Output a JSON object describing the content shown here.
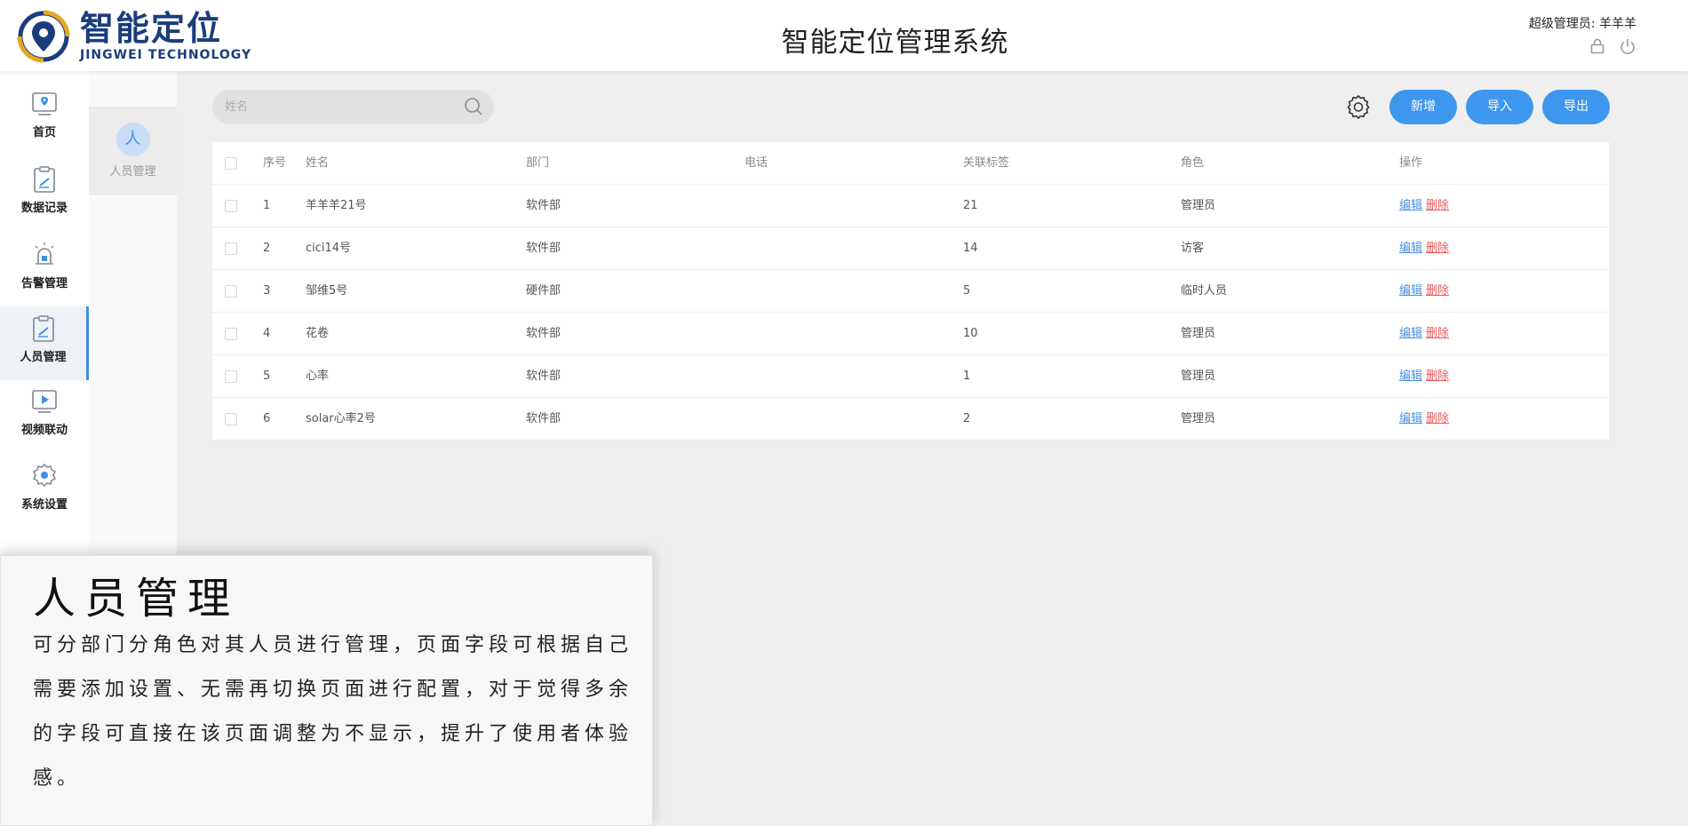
{
  "header": {
    "logo_cn": "智能定位",
    "logo_en": "JINGWEI TECHNOLOGY",
    "title": "智能定位管理系统",
    "admin_label": "超级管理员:  羊羊羊"
  },
  "sidebar": {
    "items": [
      {
        "label": "首页",
        "icon": "home-map-icon"
      },
      {
        "label": "数据记录",
        "icon": "clipboard-icon"
      },
      {
        "label": "告警管理",
        "icon": "alarm-icon"
      },
      {
        "label": "人员管理",
        "icon": "clipboard-edit-icon",
        "active": true
      },
      {
        "label": "视频联动",
        "icon": "play-icon"
      },
      {
        "label": "系统设置",
        "icon": "gear-icon"
      }
    ]
  },
  "subbar": {
    "badge": "人",
    "label": "人员管理"
  },
  "toolbar": {
    "search_placeholder": "姓名",
    "add_label": "新增",
    "import_label": "导入",
    "export_label": "导出"
  },
  "table": {
    "headers": [
      "序号",
      "姓名",
      "部门",
      "电话",
      "关联标签",
      "角色",
      "操作"
    ],
    "edit_label": "编辑",
    "delete_label": "删除",
    "rows": [
      {
        "idx": "1",
        "name": "羊羊羊21号",
        "dept": "软件部",
        "phone": "",
        "tag": "21",
        "role": "管理员"
      },
      {
        "idx": "2",
        "name": "cici14号",
        "dept": "软件部",
        "phone": "",
        "tag": "14",
        "role": "访客"
      },
      {
        "idx": "3",
        "name": "邹维5号",
        "dept": "硬件部",
        "phone": "",
        "tag": "5",
        "role": "临时人员"
      },
      {
        "idx": "4",
        "name": "花卷",
        "dept": "软件部",
        "phone": "",
        "tag": "10",
        "role": "管理员"
      },
      {
        "idx": "5",
        "name": "心率",
        "dept": "软件部",
        "phone": "",
        "tag": "1",
        "role": "管理员"
      },
      {
        "idx": "6",
        "name": "solar心率2号",
        "dept": "软件部",
        "phone": "",
        "tag": "2",
        "role": "管理员"
      }
    ]
  },
  "overlay": {
    "title": "人员管理",
    "body": "可分部门分角色对其人员进行管理，页面字段可根据自己需要添加设置、无需再切换页面进行配置，对于觉得多余的字段可直接在该页面调整为不显示，提升了使用者体验感。"
  },
  "colors": {
    "primary": "#3d97ef",
    "brand_navy": "#1a3d7c",
    "delete_red": "#e85a5a"
  }
}
